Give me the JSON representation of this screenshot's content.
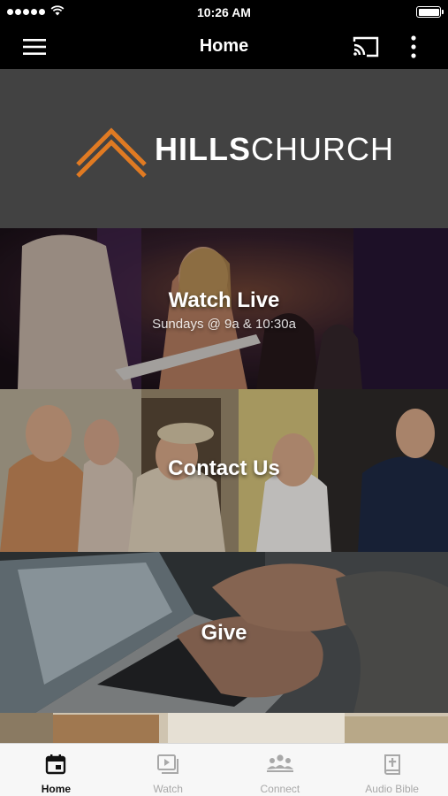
{
  "status_bar": {
    "time": "10:26 AM"
  },
  "app_bar": {
    "title": "Home"
  },
  "banner": {
    "logo_bold": "HILLS",
    "logo_light": "CHURCH",
    "logo_color": "#E07A22",
    "background": "#424242"
  },
  "tiles": [
    {
      "title": "Watch Live",
      "subtitle": "Sundays @ 9a & 10:30a"
    },
    {
      "title": "Contact Us"
    },
    {
      "title": "Give"
    }
  ],
  "tab_bar": {
    "active_index": 0,
    "items": [
      {
        "label": "Home",
        "icon": "calendar-icon"
      },
      {
        "label": "Watch",
        "icon": "video-library-icon"
      },
      {
        "label": "Connect",
        "icon": "people-icon"
      },
      {
        "label": "Audio Bible",
        "icon": "bible-icon"
      }
    ]
  }
}
